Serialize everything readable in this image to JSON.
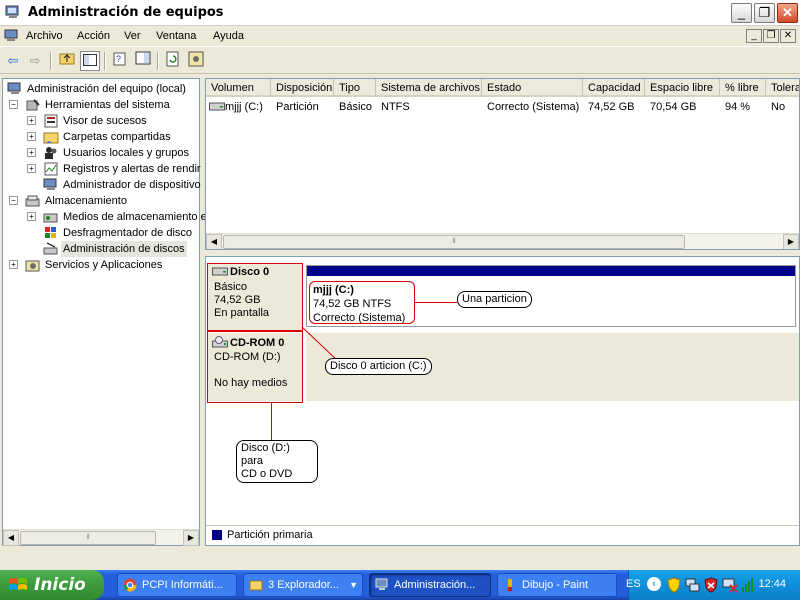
{
  "window": {
    "title": "Administración de equipos"
  },
  "menu": [
    "Archivo",
    "Acción",
    "Ver",
    "Ventana",
    "Ayuda"
  ],
  "tree": {
    "root": "Administración del equipo (local)",
    "system_tools": "Herramientas del sistema",
    "event_viewer": "Visor de sucesos",
    "shared_folders": "Carpetas compartidas",
    "local_users": "Usuarios locales y grupos",
    "perf_logs": "Registros y alertas de rendir",
    "device_manager": "Administrador de dispositivo",
    "storage": "Almacenamiento",
    "removable_storage": "Medios de almacenamiento e",
    "defrag": "Desfragmentador de disco",
    "disk_mgmt": "Administración de discos",
    "services": "Servicios y Aplicaciones"
  },
  "volume_list": {
    "columns": [
      "Volumen",
      "Disposición",
      "Tipo",
      "Sistema de archivos",
      "Estado",
      "Capacidad",
      "Espacio libre",
      "% libre",
      "Tolera"
    ],
    "rows": [
      [
        "mjjj (C:)",
        "Partición",
        "Básico",
        "NTFS",
        "Correcto (Sistema)",
        "74,52 GB",
        "70,54 GB",
        "94 %",
        "No"
      ]
    ]
  },
  "disks": {
    "disk0": {
      "name": "Disco 0",
      "type": "Básico",
      "size": "74,52 GB",
      "status": "En pantalla"
    },
    "partition_c": {
      "name": "mjjj  (C:)",
      "size_fs": "74,52 GB NTFS",
      "status": "Correcto (Sistema)"
    },
    "cdrom0": {
      "name": "CD-ROM 0",
      "drive": "CD-ROM (D:)",
      "status": "No hay medios"
    }
  },
  "annotations": {
    "partition": "Una particion",
    "disk0": "Disco 0 articion (C:)",
    "cdrom": [
      "Disco (D:) para",
      "CD o DVD"
    ]
  },
  "legend": {
    "primary_partition": "Partición primaria",
    "primary_color": "#00008b"
  },
  "taskbar": {
    "start": "Inicio",
    "tasks": [
      "PCPI Informáti...",
      "3 Explorador...",
      "Administración...",
      "Dibujo - Paint"
    ],
    "language": "ES",
    "time": "12:44"
  }
}
